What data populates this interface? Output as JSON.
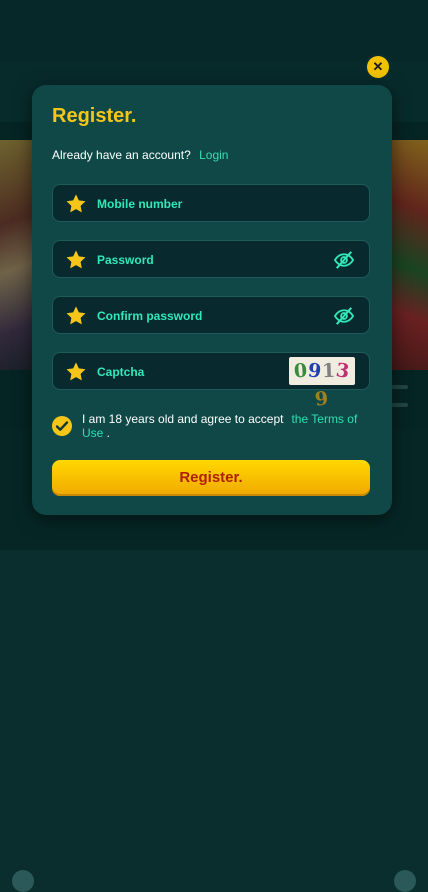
{
  "modal": {
    "title": "Register.",
    "account_prompt": "Already have an account?",
    "login_link": "Login",
    "fields": {
      "mobile": {
        "label": "Mobile number",
        "icon": "star-icon"
      },
      "password": {
        "label": "Password",
        "icon": "star-icon",
        "toggle_icon": "eye-off-icon"
      },
      "confirm_password": {
        "label": "Confirm password",
        "icon": "star-icon",
        "toggle_icon": "eye-off-icon"
      },
      "captcha": {
        "label": "Captcha",
        "icon": "star-icon",
        "code": "09139"
      }
    },
    "terms": {
      "checked": true,
      "text": "I am 18 years old and agree to accept",
      "link_part1": "the Terms of",
      "link_part2": "Use"
    },
    "register_button": "Register."
  },
  "colors": {
    "accent_yellow": "#f5c518",
    "accent_teal": "#30e8b8",
    "modal_bg": "#104848",
    "button_text": "#b02000"
  }
}
